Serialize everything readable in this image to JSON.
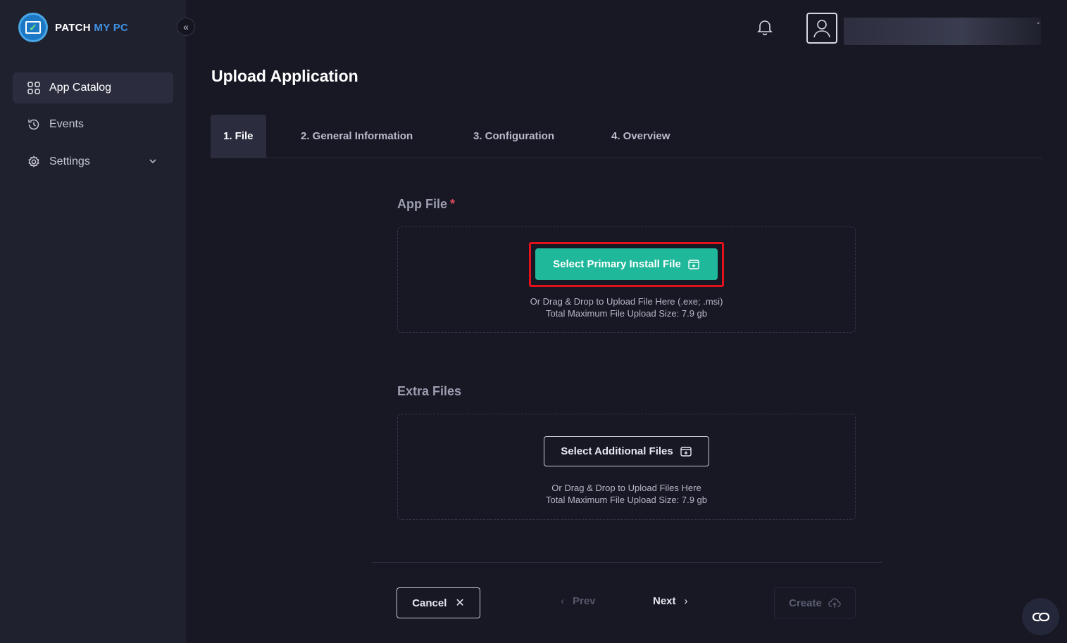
{
  "brand": {
    "name_part1": "PATCH",
    "name_part2": "MY PC"
  },
  "sidebar": {
    "items": [
      {
        "label": "App Catalog",
        "icon": "grid-icon",
        "active": true
      },
      {
        "label": "Events",
        "icon": "history-icon",
        "active": false
      },
      {
        "label": "Settings",
        "icon": "gear-icon",
        "active": false,
        "expandable": true
      }
    ]
  },
  "header": {
    "notification_icon": "bell-icon",
    "avatar_icon": "user-icon"
  },
  "page": {
    "title": "Upload Application"
  },
  "tabs": [
    {
      "label": "1. File",
      "active": true
    },
    {
      "label": "2. General Information",
      "active": false
    },
    {
      "label": "3. Configuration",
      "active": false
    },
    {
      "label": "4. Overview",
      "active": false
    }
  ],
  "app_file": {
    "label": "App File",
    "required_mark": "*",
    "button": "Select Primary Install File",
    "hint_line1": "Or Drag & Drop to Upload File Here (.exe; .msi)",
    "hint_line2": "Total Maximum File Upload Size: 7.9 gb"
  },
  "extra_files": {
    "label": "Extra Files",
    "button": "Select Additional Files",
    "hint_line1": "Or Drag & Drop to Upload Files Here",
    "hint_line2": "Total Maximum File Upload Size: 7.9 gb"
  },
  "footer": {
    "cancel": "Cancel",
    "prev": "Prev",
    "next": "Next",
    "create": "Create"
  },
  "colors": {
    "accent": "#1fb89a",
    "highlight": "#e3111b",
    "required": "#e04b63"
  }
}
